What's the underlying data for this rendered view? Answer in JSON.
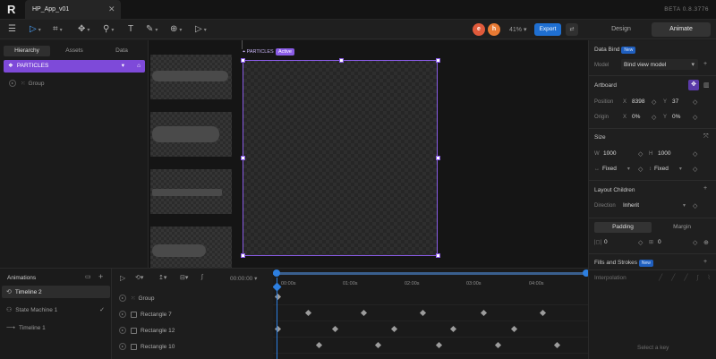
{
  "app": {
    "logo": "R",
    "file_tab": "HP_App_v01",
    "version": "BETA 0.8.3776"
  },
  "toolbar": {
    "icons": [
      "menu-icon",
      "pointer-tool-icon",
      "frame-tool-icon",
      "pen-tool-icon",
      "bone-tool-icon",
      "text-tool-icon",
      "shape-tool-icon",
      "component-tool-icon",
      "play-tool-icon"
    ],
    "avatar_1": "e",
    "avatar_1_color": "#e05a3b",
    "avatar_2": "h",
    "avatar_2_color": "#e87a33",
    "zoom": "41%",
    "export_label": "Export",
    "share_label": "⇄",
    "mode_design": "Design",
    "mode_animate": "Animate"
  },
  "left_panel": {
    "tabs": [
      "Hierarchy",
      "Assets",
      "Data"
    ],
    "selected_item": "PARTICLES",
    "child_item": "Group"
  },
  "canvas": {
    "artboard_label": "PARTICLES",
    "artboard_badge": "Active"
  },
  "right_panel": {
    "data_bind": {
      "title": "Data Bind",
      "badge": "New",
      "model_label": "Model",
      "model_value": "Bind view model"
    },
    "artboard": {
      "title": "Artboard",
      "position_label": "Position",
      "x_label": "X",
      "x": "8398",
      "y_label": "Y",
      "y": "37",
      "origin_label": "Origin",
      "ox": "0%",
      "oy": "0%"
    },
    "size": {
      "title": "Size",
      "w_label": "W",
      "w": "1000",
      "h_label": "H",
      "h": "1000",
      "w_mode": "Fixed",
      "h_mode": "Fixed"
    },
    "layout_children": {
      "title": "Layout Children",
      "direction_label": "Direction",
      "direction_value": "Inherit"
    },
    "padding_tab": "Padding",
    "margin_tab": "Margin",
    "pad_left": "0",
    "pad_right": "0",
    "fills": {
      "title": "Fills and Strokes",
      "badge": "New"
    },
    "interpolation": "Interpolation",
    "select_key": "Select a key"
  },
  "animations": {
    "title": "Animations",
    "items": [
      {
        "label": "Timeline 2",
        "selected": true
      },
      {
        "label": "State Machine 1",
        "selected": false
      },
      {
        "label": "Timeline 1",
        "selected": false
      }
    ]
  },
  "timeline": {
    "time": "00:00:00",
    "ticks": [
      "00:00s",
      "01:00s",
      "02:00s",
      "03:00s",
      "04:00s"
    ],
    "layers": [
      "Group",
      "Rectangle 7",
      "Rectangle 12",
      "Rectangle 10"
    ]
  }
}
